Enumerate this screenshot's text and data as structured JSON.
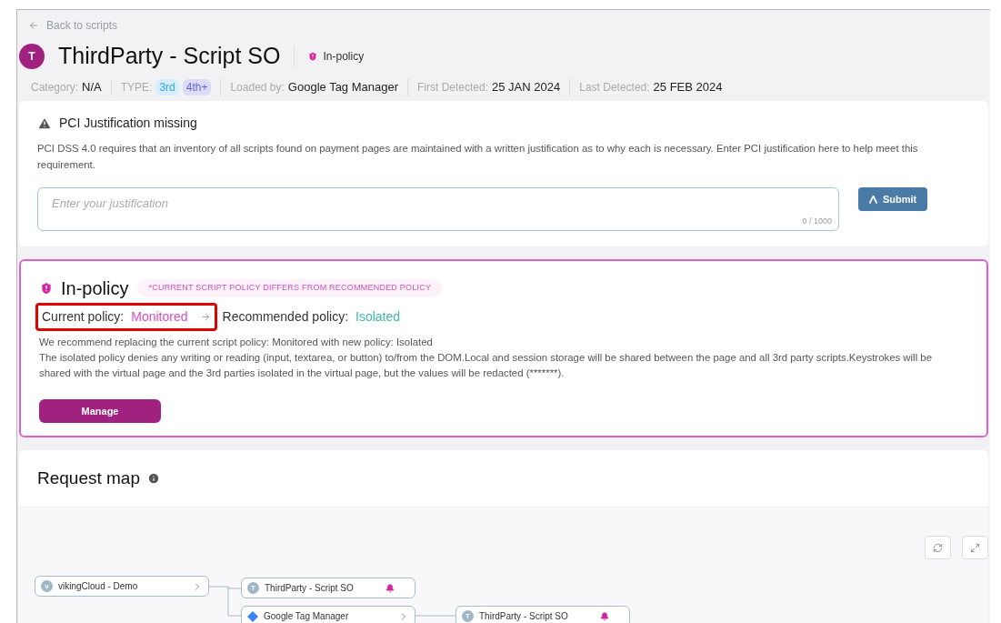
{
  "back_link": "Back to scripts",
  "header": {
    "avatar": "T",
    "title": "ThirdParty - Script SO",
    "status": "In-policy"
  },
  "meta": [
    {
      "kind": "text",
      "label": "Category:",
      "value": "N/A"
    },
    {
      "kind": "tags",
      "label": "TYPE:",
      "tags": [
        {
          "text": "3rd",
          "color": "#d3eefa"
        },
        {
          "text": "4th+",
          "color": "#dcdcf7"
        }
      ]
    },
    {
      "kind": "text",
      "label": "Loaded by:",
      "value": "Google Tag Manager"
    },
    {
      "kind": "text",
      "label": "First Detected:",
      "value": "25 JAN 2024"
    },
    {
      "kind": "text",
      "label": "Last Detected:",
      "value": "25 FEB 2024"
    }
  ],
  "justification": {
    "title": "PCI Justification missing",
    "body": "PCI DSS 4.0 requires that an inventory of all scripts found on payment pages are maintained with a written justification as to why each is necessary. Enter PCI justification here to help meet this requirement.",
    "placeholder": "Enter your justification",
    "counter": "0 / 1000",
    "submit": "Submit"
  },
  "policy": {
    "title": "In-policy",
    "notice": "*CURRENT SCRIPT POLICY DIFFERS FROM RECOMMENDED POLICY",
    "current_label": "Current policy:",
    "current": "Monitored",
    "recommended_label": "Recommended policy:",
    "recommended": "Isolated",
    "highlighted": true,
    "lines": [
      "We recommend replacing the current script policy: Monitored with new policy: Isolated",
      "The isolated policy denies any writing or reading (input, textarea, or button) to/from the DOM.Local and session storage will be shared between the page and all 3rd party scripts.Keystrokes will be shared with the virtual page and the 3rd parties isolated in the virtual page, but the values will be redacted (*******)."
    ],
    "manage": "Manage"
  },
  "request_map": {
    "title": "Request map",
    "nodes": [
      {
        "kind": "site",
        "label": "vikingCloud - Demo",
        "badge": "v",
        "expandable": true,
        "alert": false
      },
      {
        "kind": "script",
        "label": "ThirdParty - Script SO",
        "badge": "T",
        "expandable": false,
        "alert": true
      },
      {
        "kind": "manager",
        "label": "Google Tag Manager",
        "expandable": true,
        "alert": false
      },
      {
        "kind": "script",
        "label": "ThirdParty - Script SO",
        "badge": "T",
        "expandable": false,
        "alert": true
      }
    ]
  }
}
